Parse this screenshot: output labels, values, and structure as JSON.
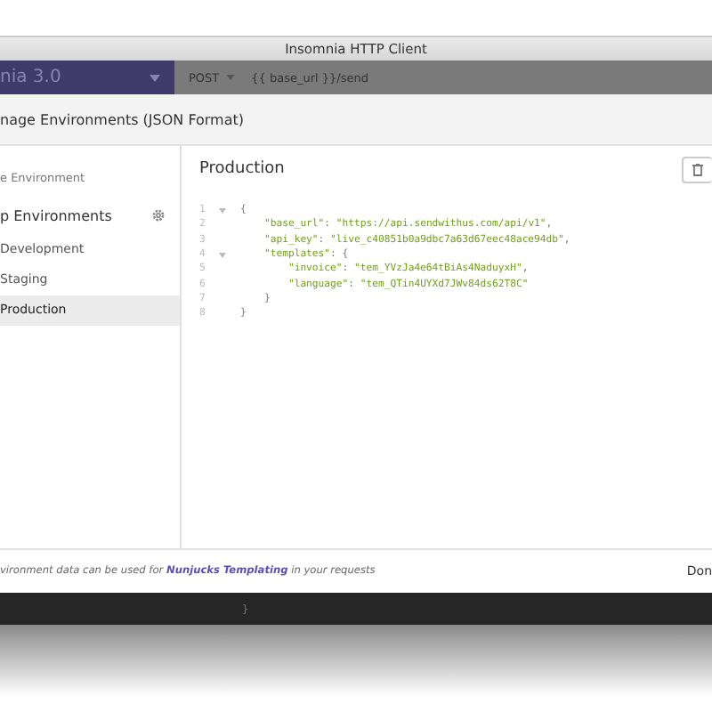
{
  "window": {
    "title": "Insomnia HTTP Client"
  },
  "app_header": {
    "workspace": "nia 3.0",
    "method": "POST",
    "url": "{{ base_url }}/send"
  },
  "modal": {
    "title": "nage Environments (JSON Format)",
    "sidebar": {
      "base": "e Environment",
      "sub_heading": "p Environments",
      "items": [
        {
          "label": "Development",
          "selected": false
        },
        {
          "label": "Staging",
          "selected": false
        },
        {
          "label": "Production",
          "selected": true
        }
      ]
    },
    "environment": {
      "name": "Production",
      "code": [
        {
          "number": "1",
          "foldable": true,
          "text": "{"
        },
        {
          "number": "2",
          "foldable": false,
          "text": "    \"base_url\": \"https://api.sendwithus.com/api/v1\","
        },
        {
          "number": "3",
          "foldable": false,
          "text": "    \"api_key\": \"live_c40851b0a9dbc7a63d67eec48ace94db\","
        },
        {
          "number": "4",
          "foldable": true,
          "text": "    \"templates\": {"
        },
        {
          "number": "5",
          "foldable": false,
          "text": "        \"invoice\": \"tem_YVzJa4e64tBiAs4NaduyxH\","
        },
        {
          "number": "6",
          "foldable": false,
          "text": "        \"language\": \"tem_QTin4UYXd7JWv84ds62T8C\""
        },
        {
          "number": "7",
          "foldable": false,
          "text": "    }"
        },
        {
          "number": "8",
          "foldable": false,
          "text": "}"
        }
      ]
    },
    "footer": {
      "before": "vironment data can be used for ",
      "link": "Nunjucks Templating",
      "after": " in your requests",
      "button": "Don"
    }
  },
  "background_code": {
    "text": "}"
  }
}
